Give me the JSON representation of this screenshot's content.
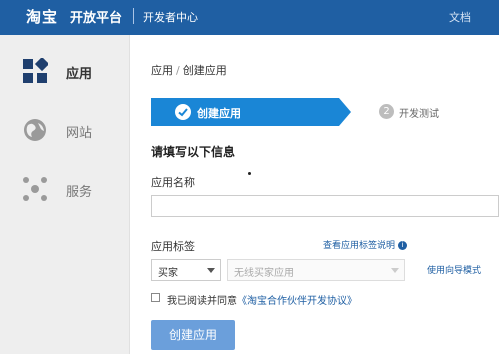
{
  "header": {
    "logo": "淘宝",
    "title": "开放平台",
    "subtitle": "开发者中心",
    "docs_link": "文档"
  },
  "sidebar": {
    "items": [
      {
        "label": "应用",
        "icon": "apps-icon",
        "active": true
      },
      {
        "label": "网站",
        "icon": "globe-icon",
        "active": false
      },
      {
        "label": "服务",
        "icon": "services-icon",
        "active": false
      }
    ]
  },
  "breadcrumb": {
    "root": "应用",
    "separator": "/",
    "current": "创建应用"
  },
  "steps": {
    "active": {
      "label": "创建应用"
    },
    "next": {
      "number": "2",
      "label": "开发测试"
    }
  },
  "form": {
    "section_title": "请填写以下信息",
    "app_name_label": "应用名称",
    "app_name_value": "",
    "tag_label": "应用标签",
    "tag_help_link": "查看应用标签说明",
    "tag_category_value": "买家",
    "tag_subcategory_placeholder": "无线买家应用",
    "wizard_link": "使用向导模式",
    "agree_prefix": "我已阅读并同意",
    "agree_link": "《淘宝合作伙伴开发协议》",
    "agree_checked": false,
    "submit_label": "创建应用"
  },
  "colors": {
    "header_bg": "#1f5fa3",
    "step_active": "#1a86d6",
    "button": "#6b9fdb",
    "link": "#1f5fa3"
  }
}
